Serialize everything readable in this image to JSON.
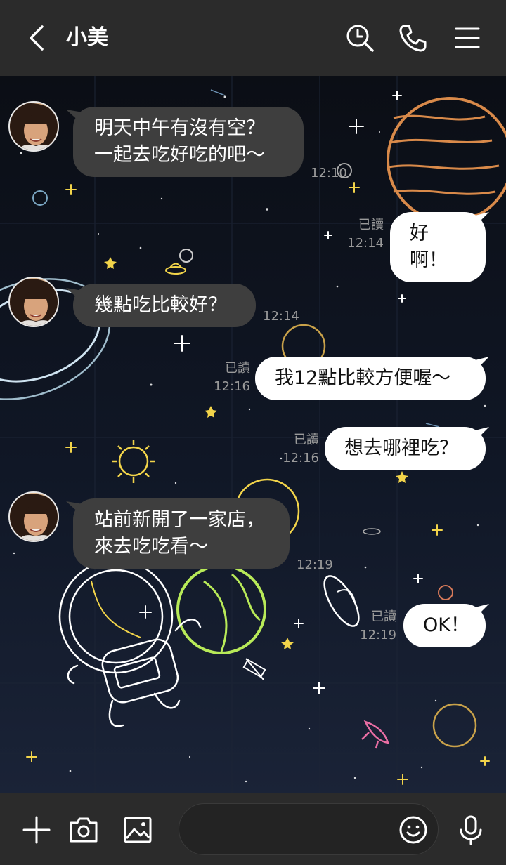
{
  "header": {
    "title": "小美",
    "icons": [
      "back-arrow-icon",
      "search-icon",
      "phone-icon",
      "menu-icon"
    ]
  },
  "messages": [
    {
      "side": "in",
      "text": "明天中午有沒有空？\n一起去吃好吃的吧～",
      "time": "12:10"
    },
    {
      "side": "out",
      "text": "好啊！",
      "read": "已讀",
      "time": "12:14"
    },
    {
      "side": "in",
      "text": "幾點吃比較好？",
      "time": "12:14"
    },
    {
      "side": "out",
      "text": "我12點比較方便喔～",
      "read": "已讀",
      "time": "12:16"
    },
    {
      "side": "out",
      "text": "想去哪裡吃？",
      "read": "已讀",
      "time": "12:16"
    },
    {
      "side": "in",
      "text": "站前新開了一家店，\n來去吃吃看～",
      "time": "12:19"
    },
    {
      "side": "out",
      "text": "OK！",
      "read": "已讀",
      "time": "12:19"
    }
  ],
  "footer": {
    "icons": [
      "plus-icon",
      "camera-icon",
      "image-icon",
      "emoji-icon",
      "microphone-icon"
    ],
    "input_placeholder": ""
  },
  "colors": {
    "header_bg": "#2b2b2b",
    "incoming_bubble": "#3e3e3e",
    "outgoing_bubble": "#ffffff",
    "background": "#101726"
  }
}
